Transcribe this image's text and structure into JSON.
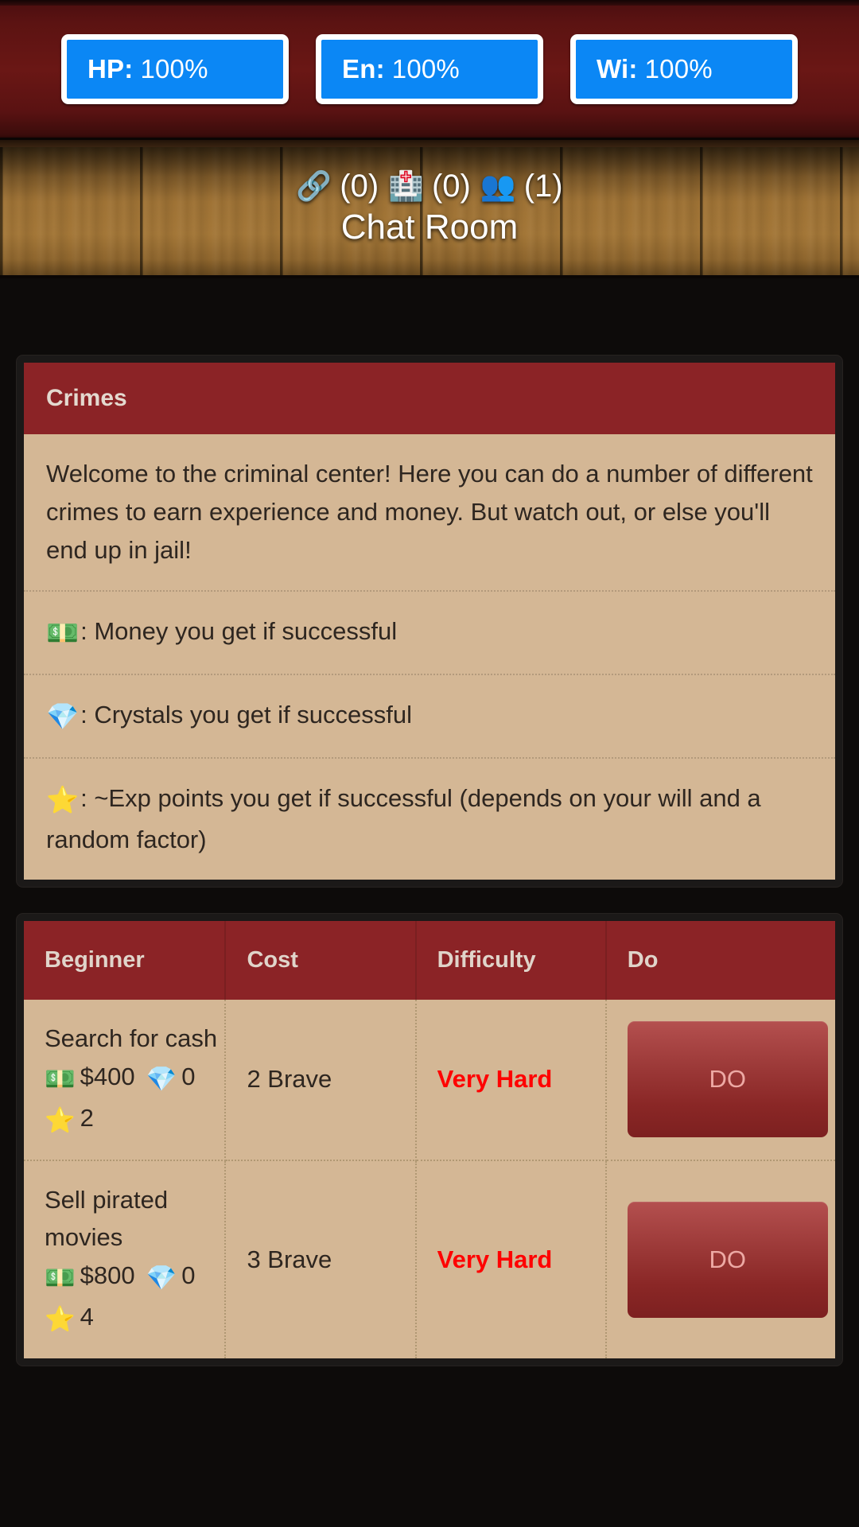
{
  "status_bar": {
    "stats": [
      {
        "key": "HP:",
        "value": "100%",
        "name": "hp"
      },
      {
        "key": "En:",
        "value": "100%",
        "name": "energy"
      },
      {
        "key": "Wi:",
        "value": "100%",
        "name": "will"
      }
    ],
    "pill_color": "#0b87f5",
    "bar_color": "#6a1715"
  },
  "wood_header": {
    "counters": [
      {
        "icon": "🔗",
        "icon_name": "handcuffs-icon",
        "count": "(0)"
      },
      {
        "icon": "🏥",
        "icon_name": "hospital-icon",
        "count": "(0)"
      },
      {
        "icon": "👥",
        "icon_name": "people-icon",
        "count": "(1)"
      }
    ],
    "chat_room_label": "Chat Room"
  },
  "crimes_panel": {
    "title": "Crimes",
    "intro": "Welcome to the criminal center! Here you can do a number of different crimes to earn experience and money. But watch out, or else you'll end up in jail!",
    "legend": [
      {
        "icon": "💵",
        "icon_name": "money-icon",
        "text": ": Money you get if successful"
      },
      {
        "icon": "💎",
        "icon_name": "crystal-icon",
        "text": ": Crystals you get if successful"
      },
      {
        "icon": "⭐",
        "icon_name": "star-icon",
        "text": ": ~Exp points you get if successful (depends on your will and a random factor)"
      }
    ]
  },
  "crimes_table": {
    "headers": {
      "name": "Beginner",
      "cost": "Cost",
      "difficulty": "Difficulty",
      "do": "Do"
    },
    "rows": [
      {
        "name": "Search for cash",
        "money_icon": "💵",
        "money": "$400",
        "crystal_icon": "💎",
        "crystals": "0",
        "star_icon": "⭐",
        "exp": "2",
        "cost": "2 Brave",
        "difficulty": "Very Hard",
        "do_label": "DO"
      },
      {
        "name": "Sell pirated movies",
        "money_icon": "💵",
        "money": "$800",
        "crystal_icon": "💎",
        "crystals": "0",
        "star_icon": "⭐",
        "exp": "4",
        "cost": "3 Brave",
        "difficulty": "Very Hard",
        "do_label": "DO"
      }
    ]
  },
  "colors": {
    "accent_red": "#8b2326",
    "panel_body": "#d4b795",
    "difficulty_red": "#ff0000",
    "stat_blue": "#0b87f5"
  }
}
